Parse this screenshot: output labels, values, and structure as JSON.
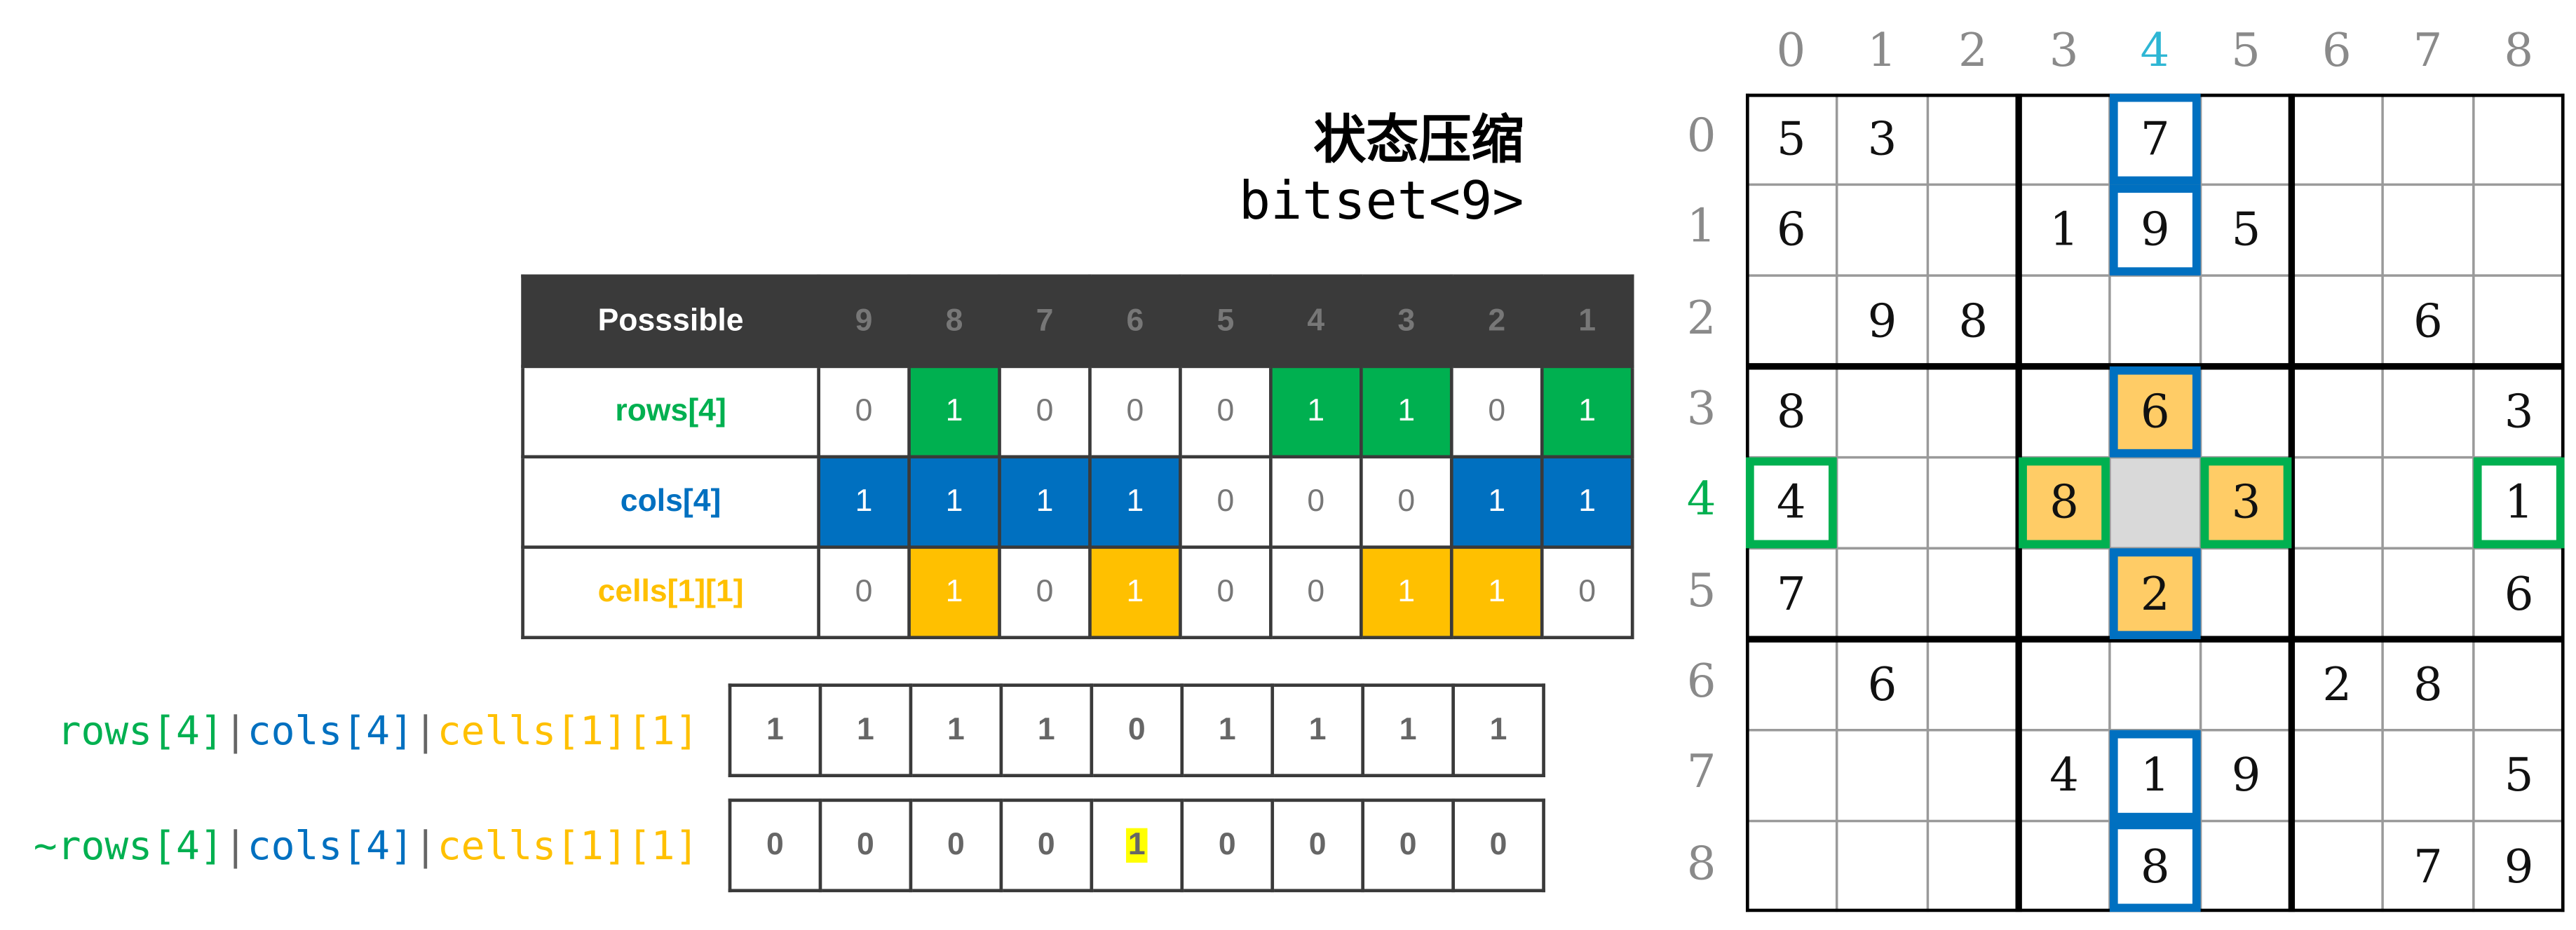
{
  "title": "状态压缩",
  "subtitle": "bitset<9>",
  "colors": {
    "green": "#00b050",
    "blue": "#0070c0",
    "yellow": "#ffc000",
    "header": "#3a3a3a",
    "cell_orange": "#ffcc66",
    "cell_gray": "#d9d9d9",
    "index_highlight": "#2eb6d4",
    "mark_yellow": "#ffff00"
  },
  "table": {
    "header": {
      "label": "Posssible",
      "bits": [
        "9",
        "8",
        "7",
        "6",
        "5",
        "4",
        "3",
        "2",
        "1"
      ]
    },
    "rows": [
      {
        "label": "rows[4]",
        "color": "#00b050",
        "bits": [
          "0",
          "1",
          "0",
          "0",
          "0",
          "1",
          "1",
          "0",
          "1"
        ]
      },
      {
        "label": "cols[4]",
        "color": "#0070c0",
        "bits": [
          "1",
          "1",
          "1",
          "1",
          "0",
          "0",
          "0",
          "1",
          "1"
        ]
      },
      {
        "label": "cells[1][1]",
        "color": "#ffc000",
        "bits": [
          "0",
          "1",
          "0",
          "1",
          "0",
          "0",
          "1",
          "1",
          "0"
        ]
      }
    ]
  },
  "results": [
    {
      "expression": {
        "prefix": "",
        "rows": "rows[4]",
        "sep1": "|",
        "cols": "cols[4]",
        "sep2": "|",
        "cells": "cells[1][1]"
      },
      "bits": [
        "1",
        "1",
        "1",
        "1",
        "0",
        "1",
        "1",
        "1",
        "1"
      ]
    },
    {
      "expression": {
        "prefix": "~",
        "rows": "rows[4]",
        "sep1": "|",
        "cols": "cols[4]",
        "sep2": "|",
        "cells": "cells[1][1]"
      },
      "bits": [
        "0",
        "0",
        "0",
        "0",
        "1",
        "0",
        "0",
        "0",
        "0"
      ],
      "highlight_index": 4
    }
  ],
  "sudoku": {
    "col_indices": [
      "0",
      "1",
      "2",
      "3",
      "4",
      "5",
      "6",
      "7",
      "8"
    ],
    "row_indices": [
      "0",
      "1",
      "2",
      "3",
      "4",
      "5",
      "6",
      "7",
      "8"
    ],
    "highlight_row": 4,
    "highlight_col": 4,
    "grid": [
      [
        "5",
        "3",
        "",
        "",
        "7",
        "",
        "",
        "",
        ""
      ],
      [
        "6",
        "",
        "",
        "1",
        "9",
        "5",
        "",
        "",
        ""
      ],
      [
        "",
        "9",
        "8",
        "",
        "",
        "",
        "",
        "6",
        ""
      ],
      [
        "8",
        "",
        "",
        "",
        "6",
        "",
        "",
        "",
        "3"
      ],
      [
        "4",
        "",
        "",
        "8",
        "",
        "3",
        "",
        "",
        "1"
      ],
      [
        "7",
        "",
        "",
        "",
        "2",
        "",
        "",
        "",
        "6"
      ],
      [
        "",
        "6",
        "",
        "",
        "",
        "",
        "2",
        "8",
        ""
      ],
      [
        "",
        "",
        "",
        "4",
        "1",
        "9",
        "",
        "",
        "5"
      ],
      [
        "",
        "",
        "",
        "",
        "8",
        "",
        "",
        "7",
        "9"
      ]
    ]
  }
}
